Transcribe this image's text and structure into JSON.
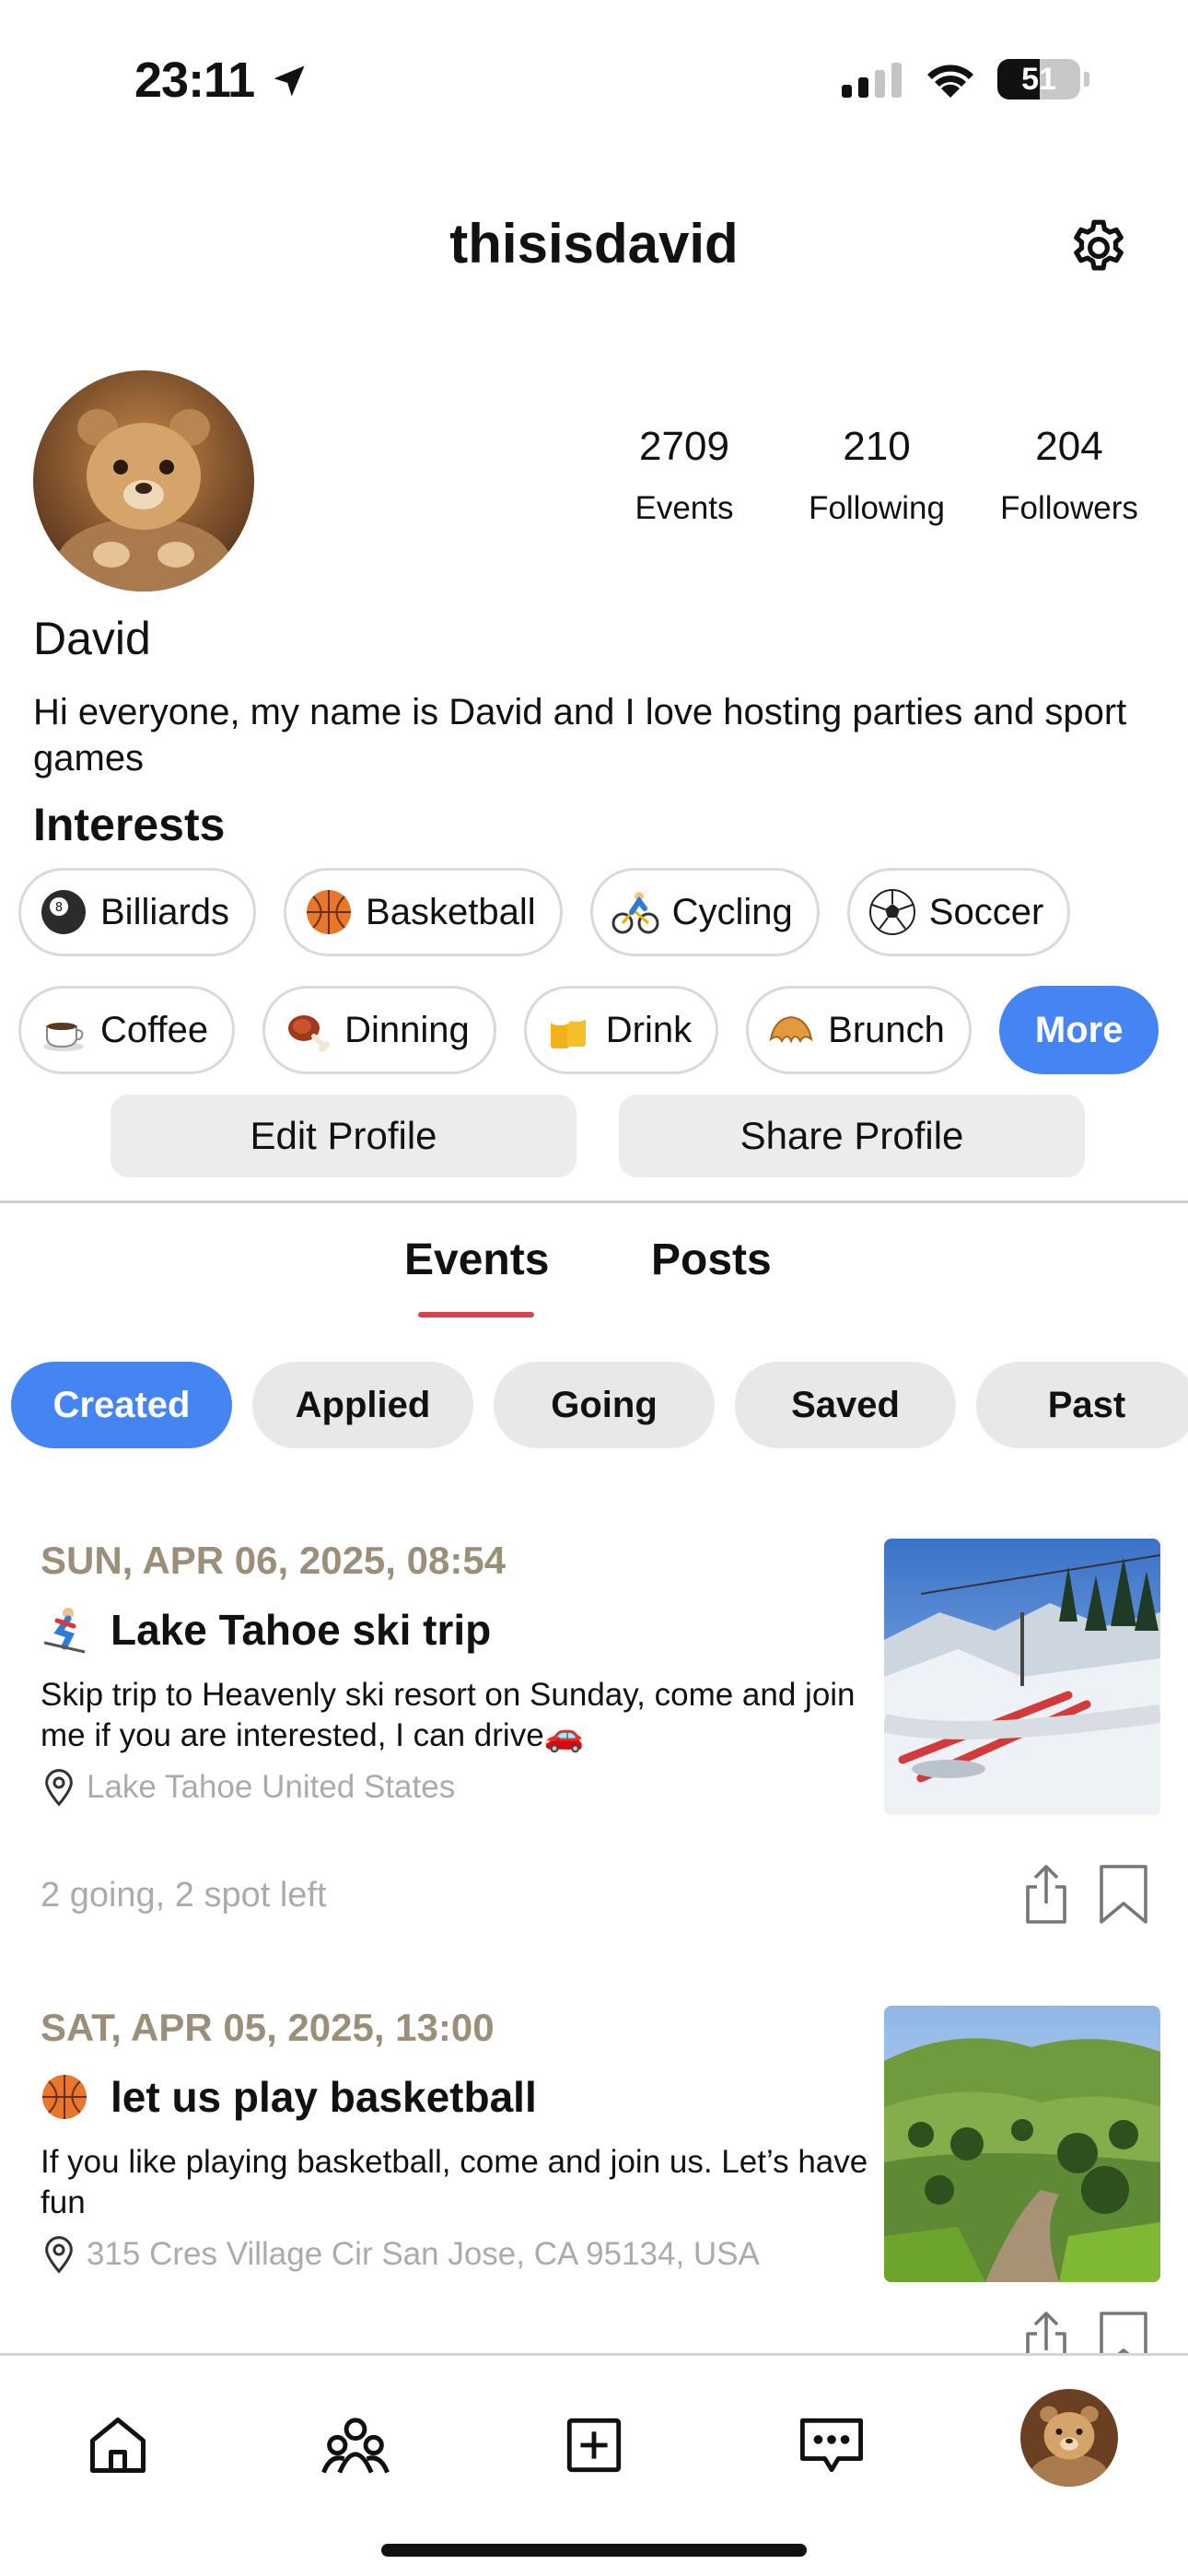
{
  "status_bar": {
    "time": "23:11",
    "battery_level": "51",
    "battery_percent": 0.51,
    "signal_bars": 2
  },
  "header": {
    "username": "thisisdavid",
    "settings_icon": "gear-icon"
  },
  "profile": {
    "stats": [
      {
        "value": "2709",
        "label": "Events"
      },
      {
        "value": "210",
        "label": "Following"
      },
      {
        "value": "204",
        "label": "Followers"
      }
    ],
    "name": "David",
    "bio": "Hi everyone, my name is David and I love hosting parties and sport games",
    "interests_title": "Interests",
    "interests_row1": [
      {
        "label": "Billiards",
        "icon": "billiard-ball-icon"
      },
      {
        "label": "Basketball",
        "icon": "basketball-icon"
      },
      {
        "label": "Cycling",
        "icon": "cyclist-icon"
      },
      {
        "label": "Soccer",
        "icon": "soccer-ball-icon"
      }
    ],
    "interests_row2": [
      {
        "label": "Coffee",
        "icon": "coffee-icon"
      },
      {
        "label": "Dinning",
        "icon": "meat-icon"
      },
      {
        "label": "Drink",
        "icon": "beer-icon"
      },
      {
        "label": "Brunch",
        "icon": "croissant-icon"
      }
    ],
    "more_label": "More",
    "edit_label": "Edit Profile",
    "share_label": "Share Profile"
  },
  "tabs": {
    "events_label": "Events",
    "posts_label": "Posts",
    "active": "Events"
  },
  "filters": [
    "Created",
    "Applied",
    "Going",
    "Saved",
    "Past"
  ],
  "active_filter": "Created",
  "events": [
    {
      "date": "SUN, APR 06, 2025, 08:54",
      "icon": "skier-icon",
      "title": "Lake Tahoe ski trip",
      "description": "Skip trip to Heavenly ski resort on Sunday, come and join me if you are interested, I can drive🚗",
      "location": "Lake Tahoe United States",
      "meta": "2 going, 2 spot left"
    },
    {
      "date": "SAT, APR 05, 2025, 13:00",
      "icon": "basketball-icon",
      "title": "let us play basketball",
      "description": "If you like playing basketball, come and join us. Let’s have fun",
      "location": "315 Cres Village Cir San Jose, CA 95134, USA"
    }
  ],
  "colors": {
    "accent": "#4585f3",
    "tab_underline": "#d9424b",
    "date_text": "#9c8f79",
    "muted_text": "#ababab",
    "chip_border": "#d9d9d9"
  },
  "bottom_nav": [
    "home-icon",
    "people-icon",
    "add-square-icon",
    "chat-icon",
    "profile-avatar"
  ]
}
